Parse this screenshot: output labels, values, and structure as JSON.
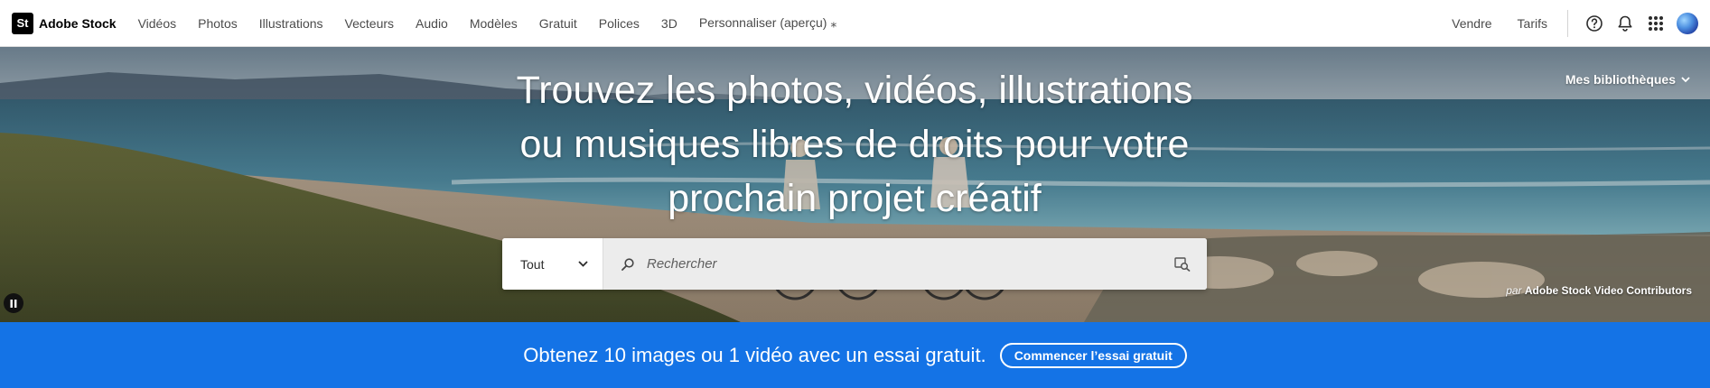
{
  "brand": {
    "logo_text": "St",
    "name": "Adobe Stock"
  },
  "nav": {
    "items": [
      "Vidéos",
      "Photos",
      "Illustrations",
      "Vecteurs",
      "Audio",
      "Modèles",
      "Gratuit",
      "Polices",
      "3D",
      "Personnaliser (aperçu) ⁎"
    ],
    "right_items": [
      "Vendre",
      "Tarifs"
    ],
    "icons": [
      "help-icon",
      "bell-icon",
      "apps-grid-icon"
    ]
  },
  "hero": {
    "title": "Trouvez les photos, vidéos, illustrations ou musiques libres de droits pour votre prochain projet créatif",
    "libraries_label": "Mes bibliothèques",
    "credit_prefix": "par",
    "credit_name": "Adobe Stock Video Contributors"
  },
  "search": {
    "category": "Tout",
    "placeholder": "Rechercher"
  },
  "promo": {
    "text": "Obtenez 10 images ou 1 vidéo avec un essai gratuit.",
    "button": "Commencer l’essai gratuit"
  },
  "colors": {
    "accent": "#1473e6",
    "brand_bg": "#000000"
  }
}
